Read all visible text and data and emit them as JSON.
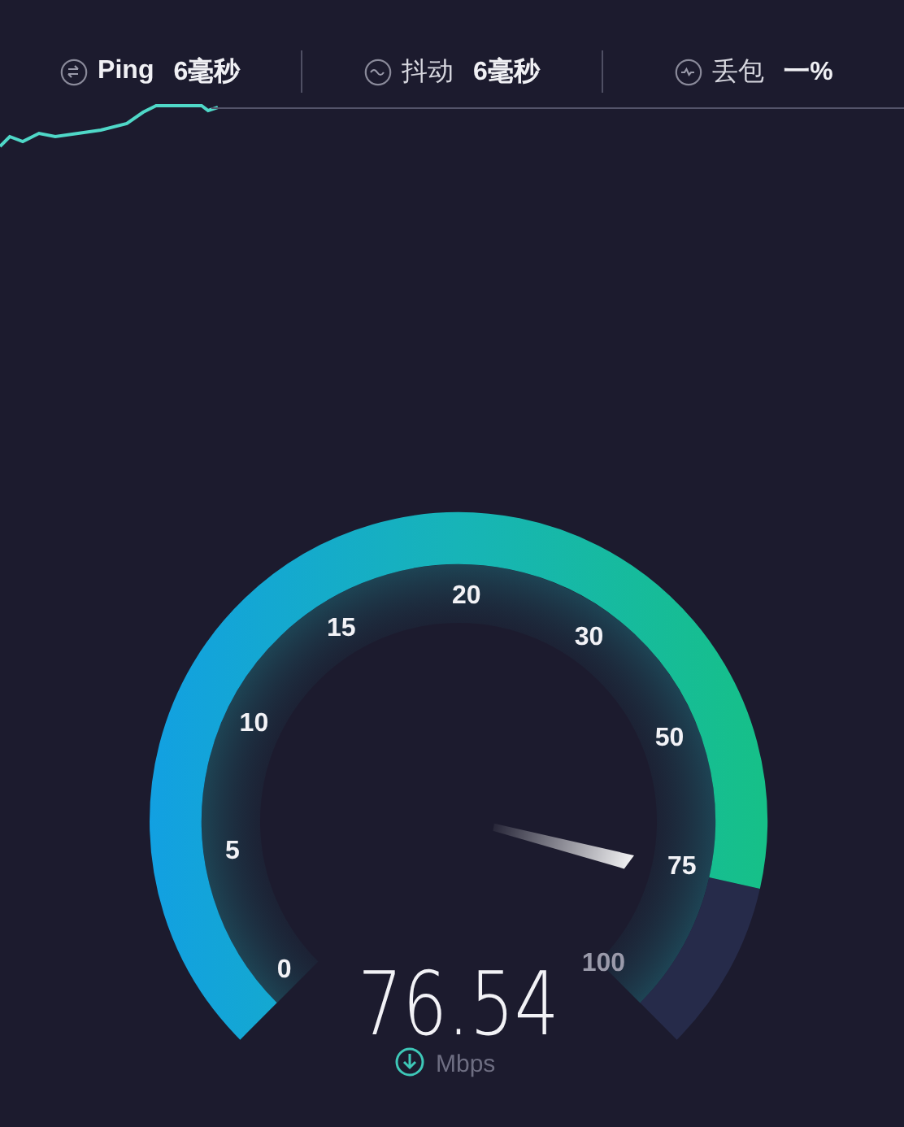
{
  "stats": [
    {
      "kind": "ping",
      "label": "Ping",
      "value": "6毫秒"
    },
    {
      "kind": "jitter",
      "label": "抖动",
      "value": "6毫秒"
    },
    {
      "kind": "loss",
      "label": "丢包",
      "value": "一%"
    }
  ],
  "gauge": {
    "ticks": [
      "0",
      "5",
      "10",
      "15",
      "20",
      "30",
      "50",
      "75",
      "100"
    ],
    "reading": "76.54",
    "unit": "Mbps"
  }
}
